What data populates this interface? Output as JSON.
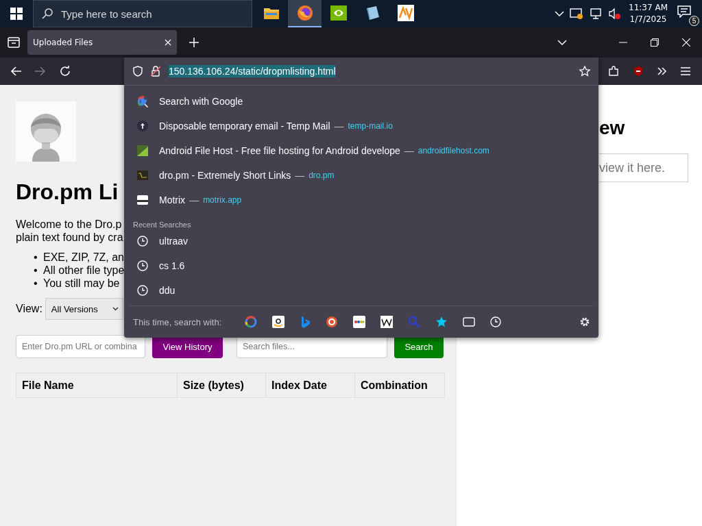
{
  "taskbar": {
    "search": {
      "placeholder": "Type here to search"
    },
    "apps": [
      {
        "kind": "folder",
        "selected": false
      },
      {
        "kind": "fox",
        "selected": true
      },
      {
        "kind": "green-tile",
        "selected": false
      },
      {
        "kind": "blue-book",
        "selected": false
      },
      {
        "kind": "zigzag",
        "selected": false
      }
    ],
    "clock": {
      "time": "11:37 AM",
      "date": "1/7/2025"
    },
    "notifications": {
      "count": "5"
    }
  },
  "tabs": [
    {
      "title": "Uploaded Files",
      "selected": true
    }
  ],
  "address_bar": {
    "url": "150.136.106.24/static/dropmlisting.html",
    "forward_disabled": true
  },
  "suggestions": [
    {
      "kind": "search",
      "title": "Search with Google"
    },
    {
      "kind": "dark-circle",
      "title": "Disposable temporary email - Temp Mail",
      "dash": "—",
      "domain": "temp-mail.io"
    },
    {
      "kind": "green-square",
      "title": "Android File Host - Free file hosting for Android develope",
      "dash": "—",
      "domain": "androidfilehost.com"
    },
    {
      "kind": "terminal",
      "title": "dro.pm - Extremely Short Links",
      "dash": "—",
      "domain": "dro.pm"
    },
    {
      "kind": "window",
      "title": "Motrix",
      "dash": "—",
      "domain": "motrix.app"
    }
  ],
  "recent_searches": {
    "label": "Recent Searches",
    "items": [
      "ultraav",
      "cs 1.6",
      "ddu"
    ]
  },
  "search_engines": {
    "label": "This time, search with:"
  },
  "page": {
    "heading": "Dro.pm Li",
    "intro": [
      "Welcome to the Dro.p",
      "plain text found by cra"
    ],
    "bullets": [
      {
        "marker": "•",
        "text": "EXE, ZIP, 7Z, an"
      },
      {
        "marker": "•",
        "text": "All other file type"
      },
      {
        "marker": "•",
        "text": "You still may be"
      }
    ],
    "view": {
      "label": "View:",
      "value": "All Versions"
    },
    "url_input": {
      "placeholder": "Enter Dro.pm URL or combina"
    },
    "history_button": "View History",
    "file_search": {
      "placeholder": "Search files..."
    },
    "search_button": "Search",
    "table": {
      "columns": [
        "File Name",
        "Size (bytes)",
        "Index Date",
        "Combination"
      ]
    },
    "preview": {
      "heading": "ew",
      "box_text": "view it here."
    }
  }
}
